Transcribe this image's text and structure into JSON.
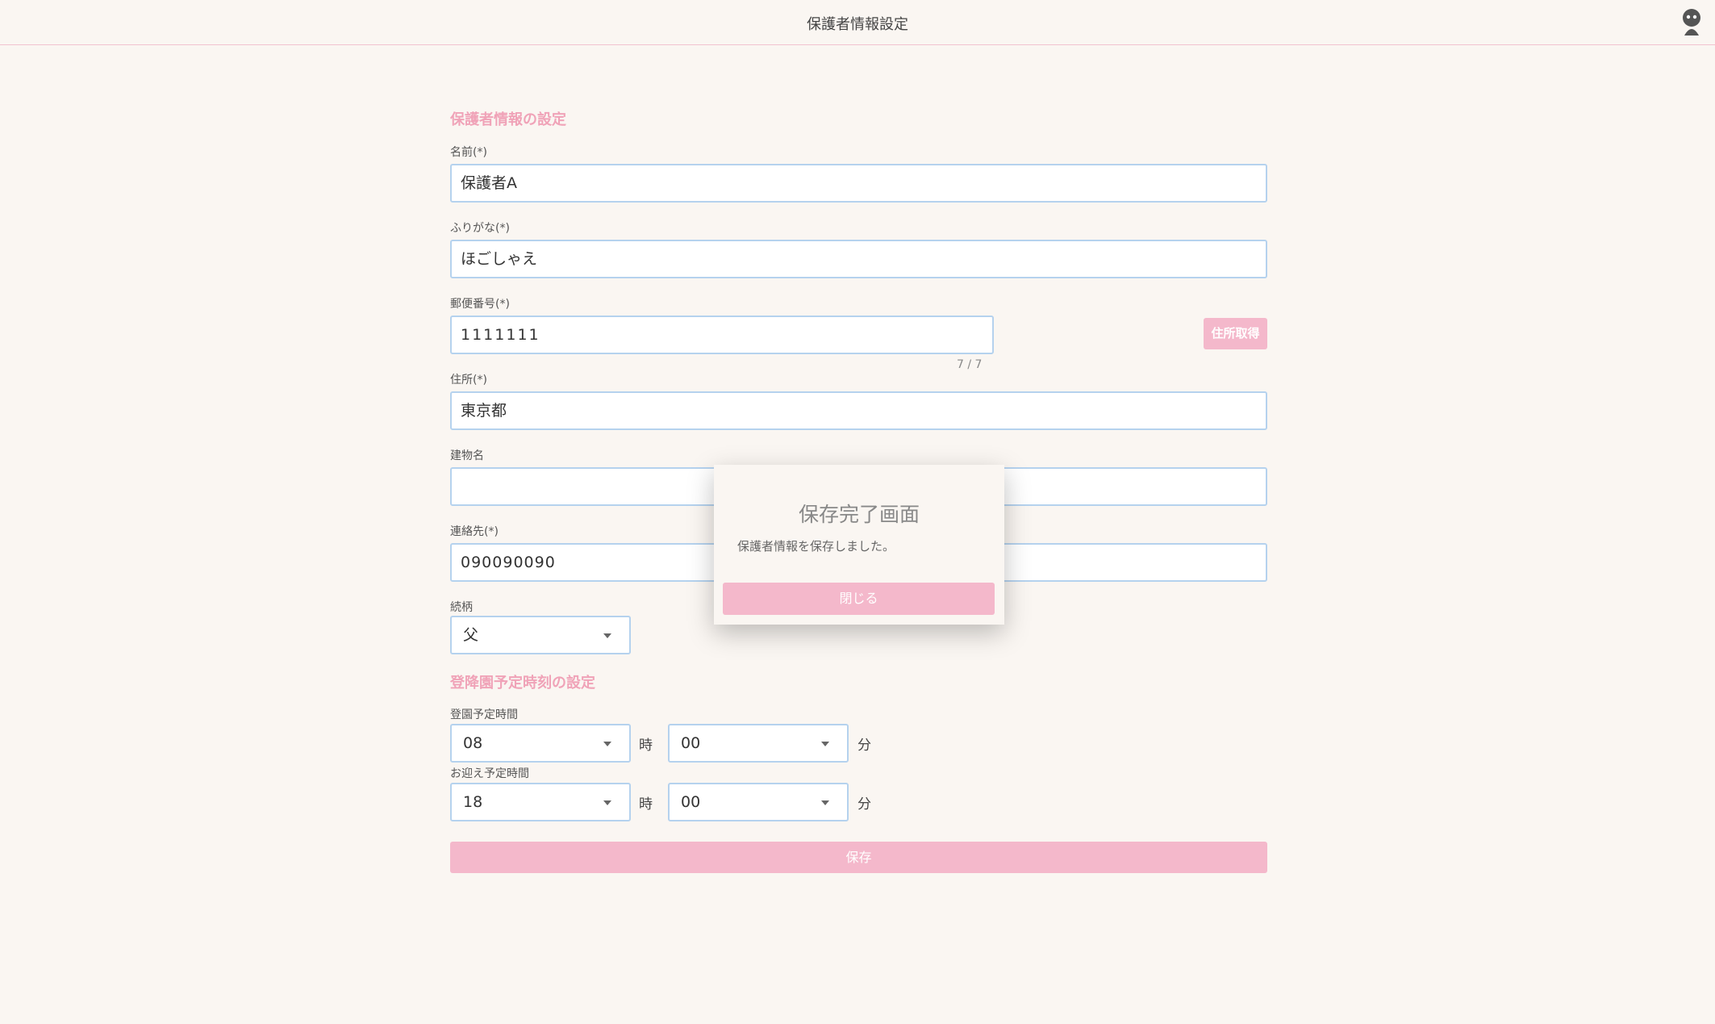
{
  "header": {
    "title": "保護者情報設定",
    "avatar_icon": "user-avatar-icon"
  },
  "guardian_section": {
    "title": "保護者情報の設定"
  },
  "fields": {
    "name": {
      "label": "名前(*)",
      "value": "保護者A"
    },
    "furigana": {
      "label": "ふりがな(*)",
      "value": "ほごしゃえ"
    },
    "postal": {
      "label": "郵便番号(*)",
      "value": "1111111",
      "counter": "7 / 7",
      "button": "住所取得"
    },
    "address": {
      "label": "住所(*)",
      "value": "東京都"
    },
    "building": {
      "label": "建物名",
      "value": ""
    },
    "contact": {
      "label": "連絡先(*)",
      "value": "090090090"
    },
    "relation": {
      "label": "続柄",
      "value": "父"
    }
  },
  "schedule_section": {
    "title": "登降園予定時刻の設定"
  },
  "schedule": {
    "arrival": {
      "label": "登園予定時間",
      "hour": "08",
      "minute": "00"
    },
    "pickup": {
      "label": "お迎え予定時間",
      "hour": "18",
      "minute": "00"
    },
    "hour_unit": "時",
    "minute_unit": "分"
  },
  "save_button": "保存",
  "modal": {
    "title": "保存完了画面",
    "message": "保護者情報を保存しました。",
    "close_button": "閉じる"
  },
  "colors": {
    "accent": "#f4b8cb",
    "accent_text": "#f0a3b8",
    "field_border": "#b5d2ee",
    "background": "#faf6f2"
  }
}
